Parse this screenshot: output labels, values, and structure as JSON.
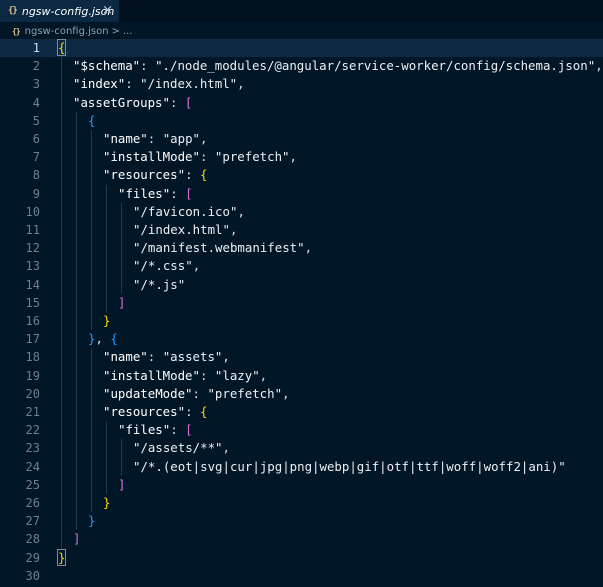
{
  "tab": {
    "icon": "{}",
    "label": "ngsw-config.json",
    "close": "×"
  },
  "breadcrumb": {
    "icon": "{}",
    "file": "ngsw-config.json",
    "separator": ">",
    "more": "..."
  },
  "editor": {
    "current_line": 1,
    "lines": [
      {
        "n": "1",
        "indent": 0,
        "tokens": [
          [
            "b1",
            "{"
          ]
        ]
      },
      {
        "n": "2",
        "indent": 1,
        "tokens": [
          [
            "key",
            "\"$schema\""
          ],
          [
            "punc",
            ": "
          ],
          [
            "str",
            "\"./node_modules/@angular/service-worker/config/schema.json\""
          ],
          [
            "punc",
            ","
          ]
        ]
      },
      {
        "n": "3",
        "indent": 1,
        "tokens": [
          [
            "key",
            "\"index\""
          ],
          [
            "punc",
            ": "
          ],
          [
            "str",
            "\"/index.html\""
          ],
          [
            "punc",
            ","
          ]
        ]
      },
      {
        "n": "4",
        "indent": 1,
        "tokens": [
          [
            "key",
            "\"assetGroups\""
          ],
          [
            "punc",
            ": "
          ],
          [
            "b2",
            "["
          ]
        ]
      },
      {
        "n": "5",
        "indent": 2,
        "tokens": [
          [
            "b3",
            "{"
          ]
        ]
      },
      {
        "n": "6",
        "indent": 3,
        "tokens": [
          [
            "key",
            "\"name\""
          ],
          [
            "punc",
            ": "
          ],
          [
            "str",
            "\"app\""
          ],
          [
            "punc",
            ","
          ]
        ]
      },
      {
        "n": "7",
        "indent": 3,
        "tokens": [
          [
            "key",
            "\"installMode\""
          ],
          [
            "punc",
            ": "
          ],
          [
            "str",
            "\"prefetch\""
          ],
          [
            "punc",
            ","
          ]
        ]
      },
      {
        "n": "8",
        "indent": 3,
        "tokens": [
          [
            "key",
            "\"resources\""
          ],
          [
            "punc",
            ": "
          ],
          [
            "b1",
            "{"
          ]
        ]
      },
      {
        "n": "9",
        "indent": 4,
        "tokens": [
          [
            "key",
            "\"files\""
          ],
          [
            "punc",
            ": "
          ],
          [
            "b2",
            "["
          ]
        ]
      },
      {
        "n": "10",
        "indent": 5,
        "tokens": [
          [
            "str",
            "\"/favicon.ico\""
          ],
          [
            "punc",
            ","
          ]
        ]
      },
      {
        "n": "11",
        "indent": 5,
        "tokens": [
          [
            "str",
            "\"/index.html\""
          ],
          [
            "punc",
            ","
          ]
        ]
      },
      {
        "n": "12",
        "indent": 5,
        "tokens": [
          [
            "str",
            "\"/manifest.webmanifest\""
          ],
          [
            "punc",
            ","
          ]
        ]
      },
      {
        "n": "13",
        "indent": 5,
        "tokens": [
          [
            "str",
            "\"/*.css\""
          ],
          [
            "punc",
            ","
          ]
        ]
      },
      {
        "n": "14",
        "indent": 5,
        "tokens": [
          [
            "str",
            "\"/*.js\""
          ]
        ]
      },
      {
        "n": "15",
        "indent": 4,
        "tokens": [
          [
            "b2",
            "]"
          ]
        ]
      },
      {
        "n": "16",
        "indent": 3,
        "tokens": [
          [
            "b1",
            "}"
          ]
        ]
      },
      {
        "n": "17",
        "indent": 2,
        "tokens": [
          [
            "b3",
            "}"
          ],
          [
            "punc",
            ", "
          ],
          [
            "b3",
            "{"
          ]
        ]
      },
      {
        "n": "18",
        "indent": 3,
        "tokens": [
          [
            "key",
            "\"name\""
          ],
          [
            "punc",
            ": "
          ],
          [
            "str",
            "\"assets\""
          ],
          [
            "punc",
            ","
          ]
        ]
      },
      {
        "n": "19",
        "indent": 3,
        "tokens": [
          [
            "key",
            "\"installMode\""
          ],
          [
            "punc",
            ": "
          ],
          [
            "str",
            "\"lazy\""
          ],
          [
            "punc",
            ","
          ]
        ]
      },
      {
        "n": "20",
        "indent": 3,
        "tokens": [
          [
            "key",
            "\"updateMode\""
          ],
          [
            "punc",
            ": "
          ],
          [
            "str",
            "\"prefetch\""
          ],
          [
            "punc",
            ","
          ]
        ]
      },
      {
        "n": "21",
        "indent": 3,
        "tokens": [
          [
            "key",
            "\"resources\""
          ],
          [
            "punc",
            ": "
          ],
          [
            "b1",
            "{"
          ]
        ]
      },
      {
        "n": "22",
        "indent": 4,
        "tokens": [
          [
            "key",
            "\"files\""
          ],
          [
            "punc",
            ": "
          ],
          [
            "b2",
            "["
          ]
        ]
      },
      {
        "n": "23",
        "indent": 5,
        "tokens": [
          [
            "str",
            "\"/assets/**\""
          ],
          [
            "punc",
            ","
          ]
        ]
      },
      {
        "n": "24",
        "indent": 5,
        "tokens": [
          [
            "str",
            "\"/*.(eot|svg|cur|jpg|png|webp|gif|otf|ttf|woff|woff2|ani)\""
          ]
        ]
      },
      {
        "n": "25",
        "indent": 4,
        "tokens": [
          [
            "b2",
            "]"
          ]
        ]
      },
      {
        "n": "26",
        "indent": 3,
        "tokens": [
          [
            "b1",
            "}"
          ]
        ]
      },
      {
        "n": "27",
        "indent": 2,
        "tokens": [
          [
            "b3",
            "}"
          ]
        ]
      },
      {
        "n": "28",
        "indent": 1,
        "tokens": [
          [
            "b2",
            "]"
          ]
        ]
      },
      {
        "n": "29",
        "indent": 0,
        "tokens": [
          [
            "b1",
            "}"
          ]
        ]
      },
      {
        "n": "30",
        "indent": 0,
        "tokens": []
      }
    ]
  },
  "colors": {
    "background": "#011627",
    "tab_active": "#0b2942",
    "bracket_level1": "#ffd700",
    "bracket_level2": "#da70d6",
    "bracket_level3": "#179fff",
    "string": "#ecf0f4",
    "line_number": "#6d7f92"
  }
}
